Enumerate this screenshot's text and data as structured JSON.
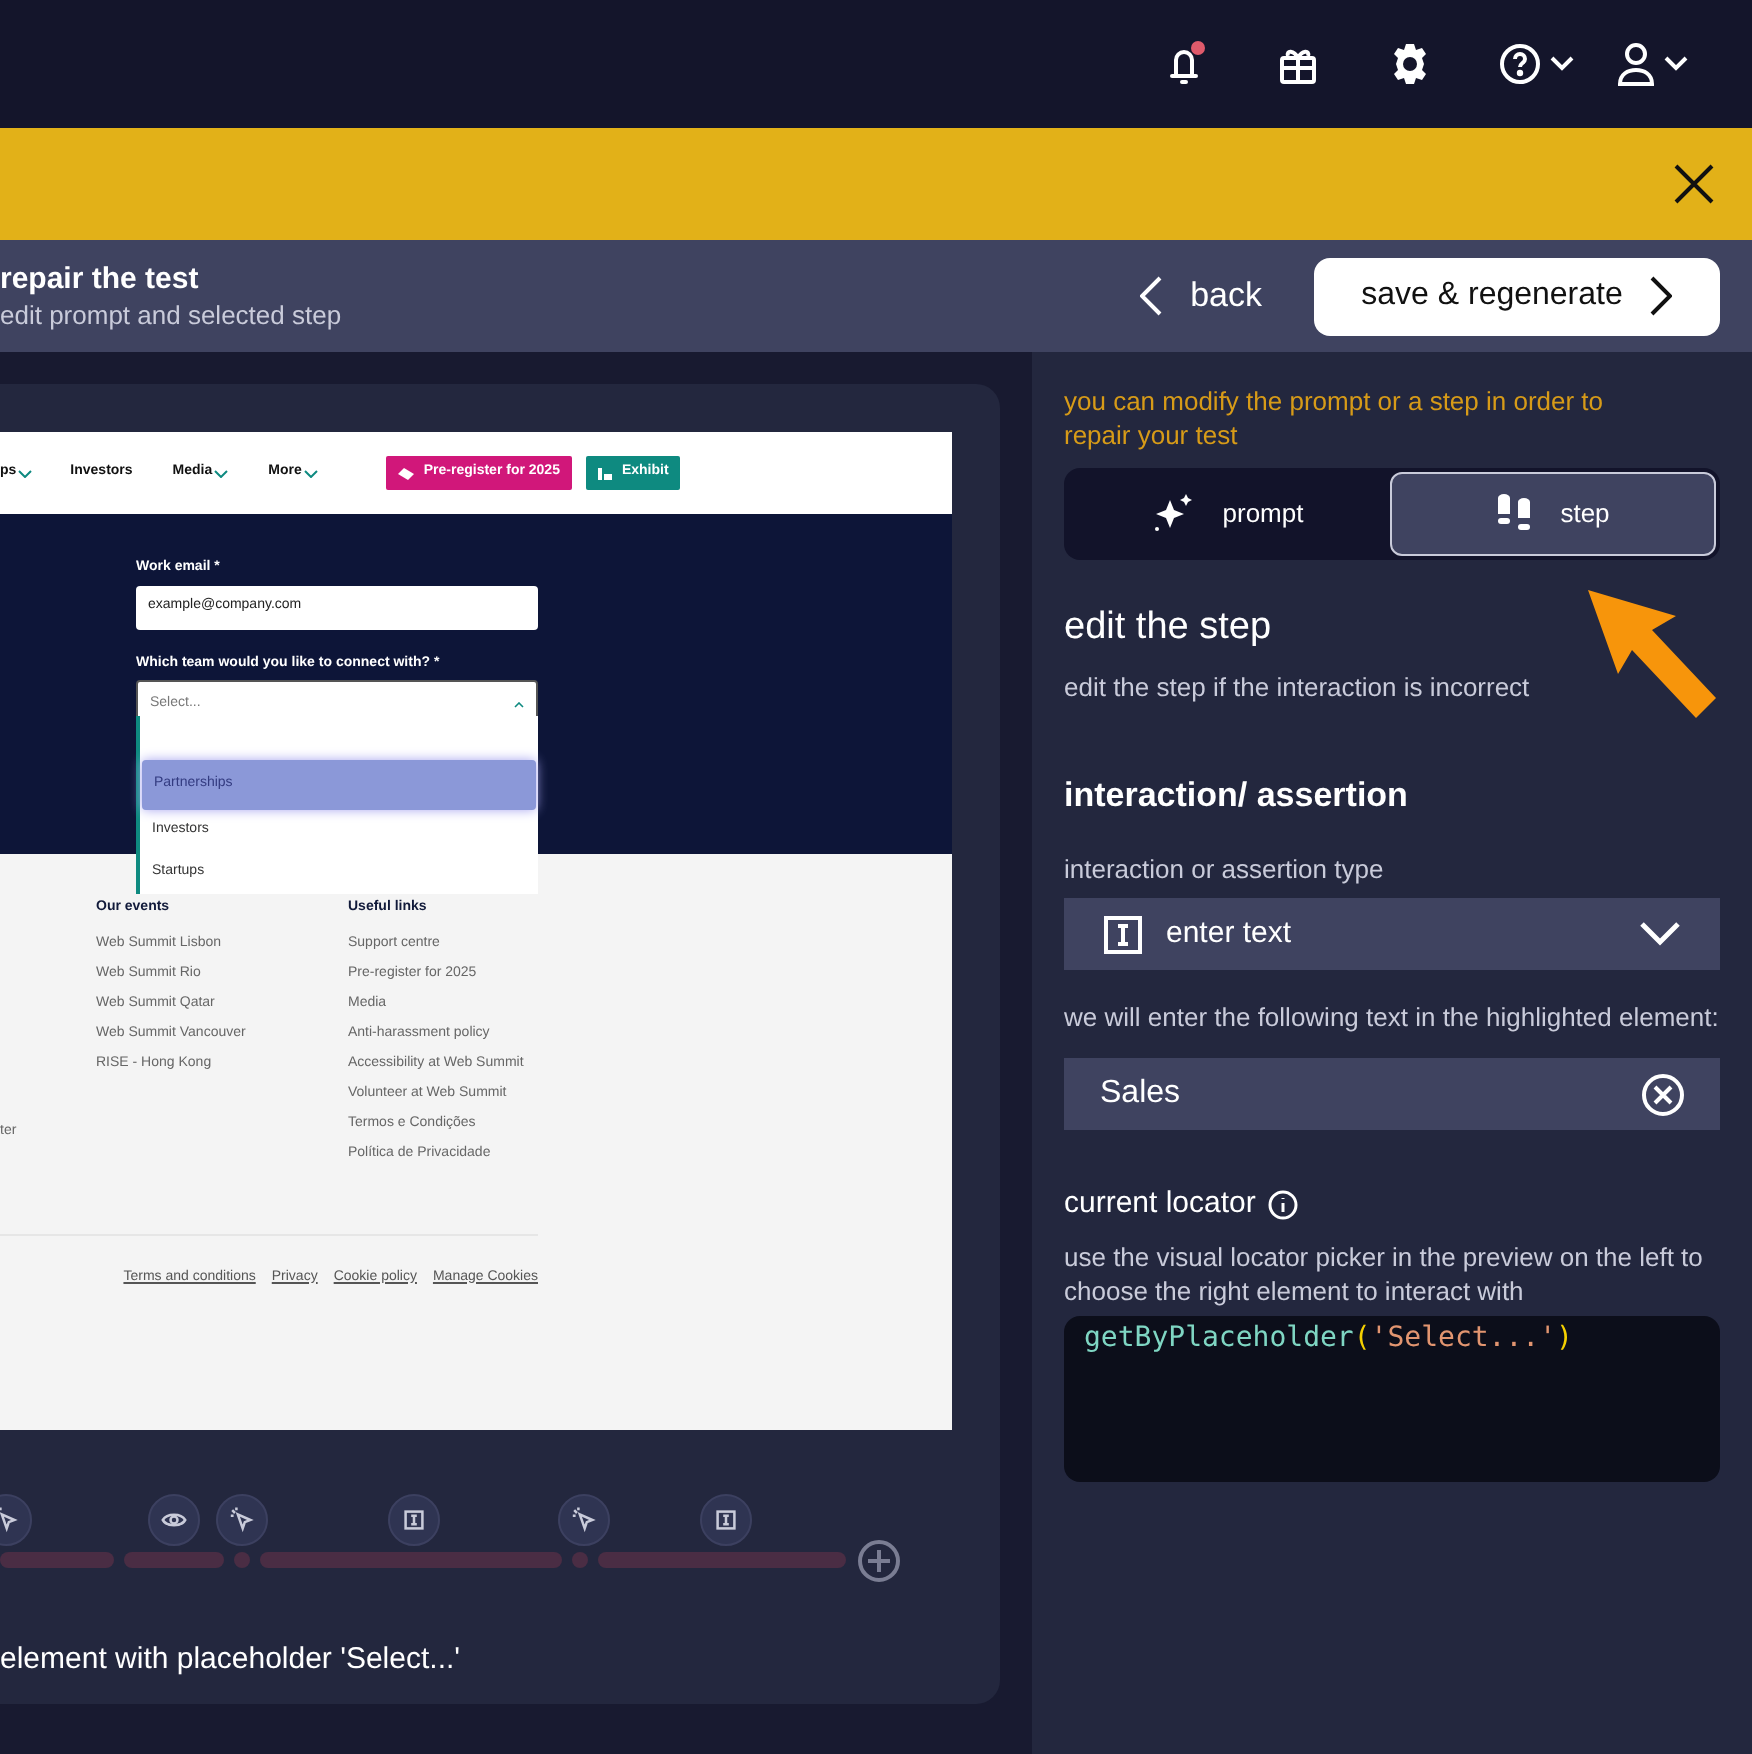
{
  "header": {
    "title": "repair the test",
    "subtitle": "edit prompt and selected step",
    "back": "back",
    "save": "save & regenerate"
  },
  "preview": {
    "nav": [
      {
        "label": "ps",
        "kind": "menu"
      },
      {
        "label": "Investors",
        "kind": "link"
      },
      {
        "label": "Media",
        "kind": "menu"
      },
      {
        "label": "More",
        "kind": "menu"
      }
    ],
    "nav_buttons": [
      {
        "label": "Pre-register for 2025",
        "color": "#d1177a",
        "kind": "ticket"
      },
      {
        "label": "Exhibit",
        "color": "#0e8a80",
        "kind": "booth"
      }
    ],
    "email_label": "Work email *",
    "email_value": "example@company.com",
    "team_label": "Which team would you like to connect with? *",
    "team_placeholder": "Select...",
    "options": [
      {
        "label": "Partnerships",
        "selected": true
      },
      {
        "label": "Investors",
        "selected": false
      },
      {
        "label": "Startups",
        "selected": false
      }
    ],
    "footer_fragment": "ter",
    "footer_columns": [
      {
        "heading": "Our events",
        "links": [
          "Web Summit Lisbon",
          "Web Summit Rio",
          "Web Summit Qatar",
          "Web Summit Vancouver",
          "RISE - Hong Kong"
        ]
      },
      {
        "heading": "Useful links",
        "links": [
          "Support centre",
          "Pre-register for 2025",
          "Media",
          "Anti-harassment policy",
          "Accessibility at Web Summit",
          "Volunteer at Web Summit",
          "Termos e Condições",
          "Política de Privacidade"
        ]
      }
    ],
    "legal_links": [
      "Terms and conditions",
      "Privacy",
      "Cookie policy",
      "Manage Cookies"
    ]
  },
  "timeline": {
    "steps": [
      {
        "kind": "click"
      },
      {
        "kind": "view"
      },
      {
        "kind": "click"
      },
      {
        "kind": "type"
      },
      {
        "kind": "click"
      },
      {
        "kind": "type"
      }
    ]
  },
  "step_description": "element with placeholder 'Select...'",
  "panel": {
    "hint": "you can modify the prompt or a step in order to repair your test",
    "modes": [
      {
        "label": "prompt",
        "kind": "prompt",
        "selected": false
      },
      {
        "label": "step",
        "kind": "step",
        "selected": true
      }
    ],
    "section_title": "edit the step",
    "section_hint": "edit the step if the interaction is incorrect",
    "interaction_heading": "interaction/ assertion",
    "type_label": "interaction or assertion type",
    "type_value": "enter text",
    "text_label": "we will enter the following text in the highlighted element:",
    "text_value": "Sales",
    "locator_label": "current locator",
    "locator_hint": "use the visual locator picker in the preview on the left to choose the right element to interact with",
    "locator_code": "getByPlaceholder('Select...')"
  }
}
